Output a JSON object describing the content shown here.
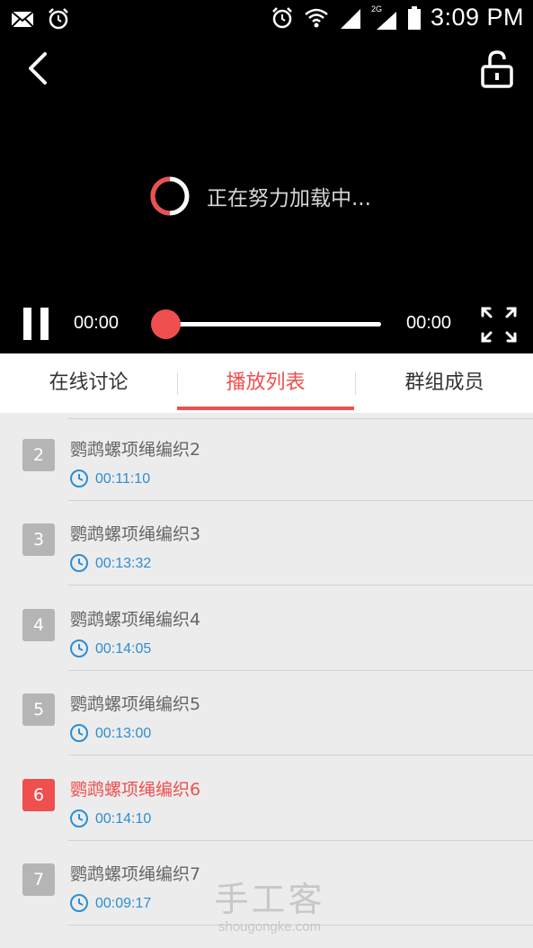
{
  "status_bar": {
    "time": "3:09 PM",
    "network_label": "2G",
    "left_icons": [
      "mail-icon",
      "alarm-icon"
    ],
    "right_icons": [
      "alarm-icon",
      "wifi-icon",
      "signal-icon",
      "signal-2g-icon",
      "battery-icon"
    ]
  },
  "player": {
    "loading_text": "正在努力加载中...",
    "current_time": "00:00",
    "total_time": "00:00",
    "progress": 0,
    "icons": [
      "back-arrow-icon",
      "unlock-icon",
      "loading-spinner-icon",
      "pause-icon",
      "fullscreen-icon"
    ]
  },
  "tabs": [
    {
      "label": "在线讨论",
      "active": false
    },
    {
      "label": "播放列表",
      "active": true
    },
    {
      "label": "群组成员",
      "active": false
    }
  ],
  "playlist": [
    {
      "number": "2",
      "title": "鹦鹉螺项绳编织2",
      "duration": "00:11:10",
      "active": false
    },
    {
      "number": "3",
      "title": "鹦鹉螺项绳编织3",
      "duration": "00:13:32",
      "active": false
    },
    {
      "number": "4",
      "title": "鹦鹉螺项绳编织4",
      "duration": "00:14:05",
      "active": false
    },
    {
      "number": "5",
      "title": "鹦鹉螺项绳编织5",
      "duration": "00:13:00",
      "active": false
    },
    {
      "number": "6",
      "title": "鹦鹉螺项绳编织6",
      "duration": "00:14:10",
      "active": true
    },
    {
      "number": "7",
      "title": "鹦鹉螺项绳编织7",
      "duration": "00:09:17",
      "active": false
    }
  ],
  "watermark": {
    "title": "手工客",
    "url": "shougongke.com"
  },
  "colors": {
    "accent": "#ef4f4f",
    "duration": "#2c8ed6",
    "badge": "#b5b5b5",
    "list_bg": "#ececec"
  }
}
